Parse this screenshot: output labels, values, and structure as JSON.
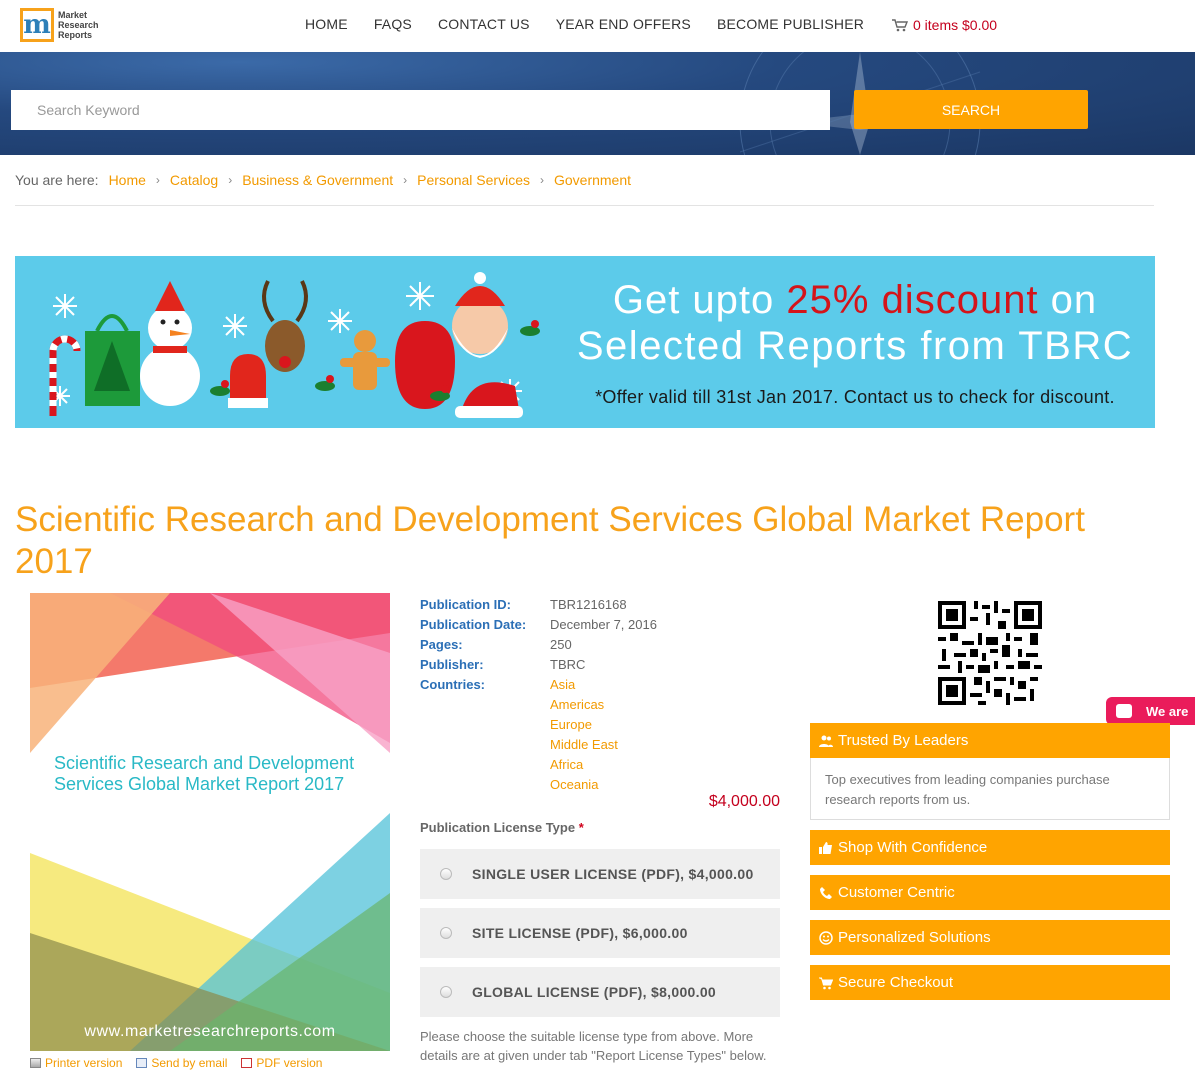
{
  "header": {
    "logo_text": "Market\nResearch\nReports",
    "logo_letter": "m",
    "nav": [
      "HOME",
      "FAQS",
      "CONTACT US",
      "YEAR END OFFERS",
      "BECOME PUBLISHER"
    ],
    "cart": "0 items $0.00"
  },
  "search": {
    "placeholder": "Search Keyword",
    "button": "SEARCH"
  },
  "breadcrumb": {
    "label": "You are here:",
    "items": [
      "Home",
      "Catalog",
      "Business & Government",
      "Personal Services",
      "Government"
    ]
  },
  "promo": {
    "line1_pre": "Get upto ",
    "line1_highlight": "25% discount",
    "line1_post": " on",
    "line2": "Selected Reports from TBRC",
    "line3": "*Offer valid till 31st Jan 2017. Contact us to check for discount."
  },
  "report": {
    "title": "Scientific Research and Development Services Global Market Report 2017",
    "cover_title": "Scientific Research and Development Services Global Market Report 2017",
    "cover_url": "www.marketresearchreports.com",
    "details": [
      {
        "label": "Publication ID:",
        "value": "TBR1216168"
      },
      {
        "label": "Publication Date:",
        "value": "December 7, 2016"
      },
      {
        "label": "Pages:",
        "value": "250"
      },
      {
        "label": "Publisher:",
        "value": "TBRC"
      }
    ],
    "countries_label": "Countries:",
    "countries": [
      "Asia",
      "Americas",
      "Europe",
      "Middle East",
      "Africa",
      "Oceania"
    ],
    "price": "$4,000.00",
    "license_label": "Publication License Type",
    "required_mark": "*",
    "licenses": [
      "SINGLE USER LICENSE (PDF), $4,000.00",
      "SITE LICENSE (PDF), $6,000.00",
      "GLOBAL LICENSE (PDF), $8,000.00"
    ],
    "license_note": "Please choose the suitable license type from above. More details are at given under tab \"Report License Types\" below."
  },
  "tools": [
    "Printer version",
    "Send by email",
    "PDF version"
  ],
  "chat": "We are",
  "sidebar": {
    "trusted_title": "Trusted By Leaders",
    "trusted_body": "Top executives from leading companies purchase research reports from us.",
    "items": [
      "Shop With Confidence",
      "Customer Centric",
      "Personalized Solutions",
      "Secure Checkout"
    ]
  },
  "colors": {
    "accent": "#ffa400",
    "title": "#f7a21b",
    "link": "#f29a00",
    "label_blue": "#2b6fb6",
    "price_red": "#c4001d",
    "promo_bg": "#5ccbea"
  }
}
